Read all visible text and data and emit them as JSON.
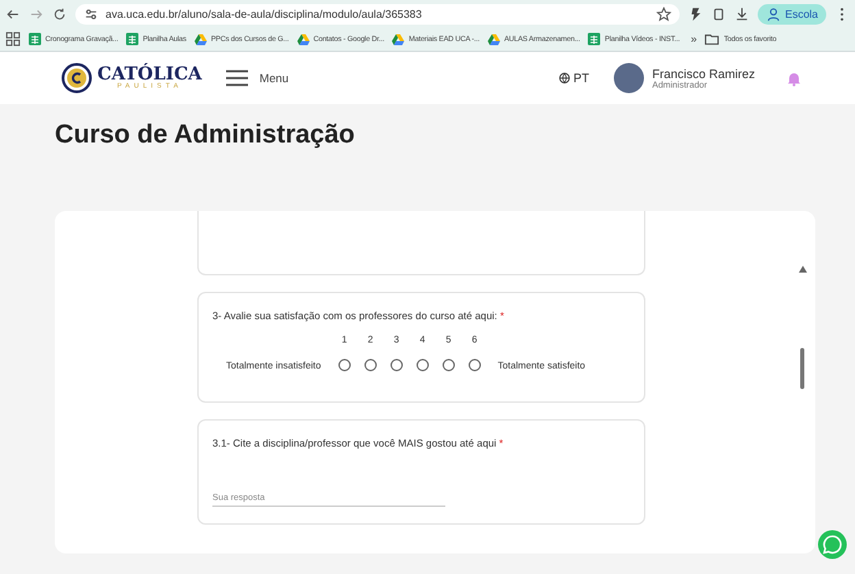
{
  "browser": {
    "url": "ava.uca.edu.br/aluno/sala-de-aula/disciplina/modulo/aula/365383",
    "profile": "Escola",
    "bookmarks": [
      {
        "kind": "sheet",
        "label": "Cronograma Gravaçã..."
      },
      {
        "kind": "sheet",
        "label": "Planilha Aulas"
      },
      {
        "kind": "drive",
        "label": "PPCs dos Cursos de G..."
      },
      {
        "kind": "drive",
        "label": "Contatos - Google Dr..."
      },
      {
        "kind": "drive",
        "label": "Materiais EAD UCA -..."
      },
      {
        "kind": "drive",
        "label": "AULAS Armazenamen..."
      },
      {
        "kind": "sheet",
        "label": "Planilha Vídeos - INST..."
      }
    ],
    "more": "»",
    "all_bookmarks": "Todos os favorito"
  },
  "header": {
    "logo": "CATÓLICA",
    "logo_sub": "PAULISTA",
    "menu": "Menu",
    "language": "PT",
    "user_name": "Francisco Ramirez",
    "user_role": "Administrador"
  },
  "page_title": "Curso de Administração",
  "questions": [
    {
      "kind": "scale",
      "title": "3- Avalie sua satisfação com os professores do curso até aqui:",
      "required_mark": "*",
      "low_label": "Totalmente insatisfeito",
      "high_label": "Totalmente satisfeito",
      "options": [
        {
          "label": "1",
          "selected": false
        },
        {
          "label": "2",
          "selected": false
        },
        {
          "label": "3",
          "selected": false
        },
        {
          "label": "4",
          "selected": false
        },
        {
          "label": "5",
          "selected": false
        },
        {
          "label": "6",
          "selected": false
        }
      ]
    },
    {
      "kind": "text",
      "title": "3.1- Cite a disciplina/professor que você MAIS gostou até aqui",
      "required_mark": "*",
      "placeholder": "Sua resposta"
    }
  ]
}
